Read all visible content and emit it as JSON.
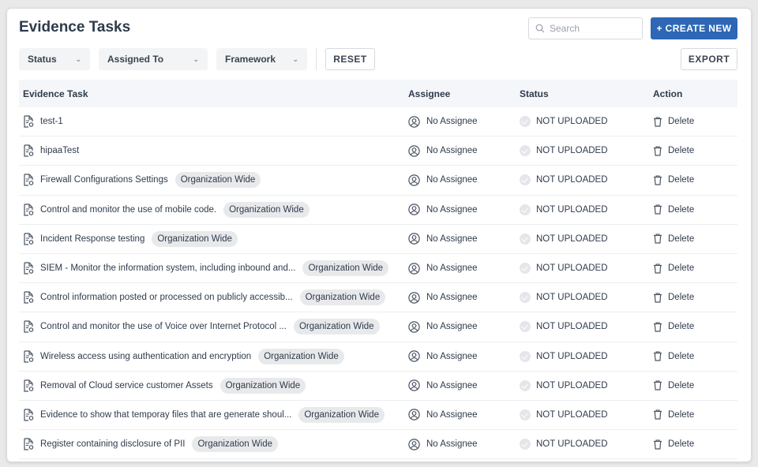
{
  "page": {
    "title": "Evidence Tasks"
  },
  "search": {
    "placeholder": "Search"
  },
  "buttons": {
    "create_new": "+ CREATE NEW",
    "reset": "RESET",
    "export": "EXPORT"
  },
  "filters": [
    {
      "label": "Status"
    },
    {
      "label": "Assigned To"
    },
    {
      "label": "Framework"
    }
  ],
  "table": {
    "headers": {
      "task": "Evidence Task",
      "assignee": "Assignee",
      "status": "Status",
      "action": "Action"
    },
    "rows": [
      {
        "task": "test-1",
        "tag": "",
        "assignee": "No Assignee",
        "status": "NOT UPLOADED",
        "action": "Delete"
      },
      {
        "task": "hipaaTest",
        "tag": "",
        "assignee": "No Assignee",
        "status": "NOT UPLOADED",
        "action": "Delete"
      },
      {
        "task": "Firewall Configurations Settings",
        "tag": "Organization Wide",
        "assignee": "No Assignee",
        "status": "NOT UPLOADED",
        "action": "Delete"
      },
      {
        "task": "Control and monitor the use of mobile code.",
        "tag": "Organization Wide",
        "assignee": "No Assignee",
        "status": "NOT UPLOADED",
        "action": "Delete"
      },
      {
        "task": "Incident Response testing",
        "tag": "Organization Wide",
        "assignee": "No Assignee",
        "status": "NOT UPLOADED",
        "action": "Delete"
      },
      {
        "task": "SIEM - Monitor the information system, including inbound and...",
        "tag": "Organization Wide",
        "assignee": "No Assignee",
        "status": "NOT UPLOADED",
        "action": "Delete"
      },
      {
        "task": "Control information posted or processed on publicly accessib...",
        "tag": "Organization Wide",
        "assignee": "No Assignee",
        "status": "NOT UPLOADED",
        "action": "Delete"
      },
      {
        "task": "Control and monitor the use of Voice over Internet Protocol ...",
        "tag": "Organization Wide",
        "assignee": "No Assignee",
        "status": "NOT UPLOADED",
        "action": "Delete"
      },
      {
        "task": "Wireless access using authentication and encryption",
        "tag": "Organization Wide",
        "assignee": "No Assignee",
        "status": "NOT UPLOADED",
        "action": "Delete"
      },
      {
        "task": "Removal of Cloud service customer Assets",
        "tag": "Organization Wide",
        "assignee": "No Assignee",
        "status": "NOT UPLOADED",
        "action": "Delete"
      },
      {
        "task": "Evidence to show that temporay files that are generate shoul...",
        "tag": "Organization Wide",
        "assignee": "No Assignee",
        "status": "NOT UPLOADED",
        "action": "Delete"
      },
      {
        "task": "Register containing disclosure of PII",
        "tag": "Organization Wide",
        "assignee": "No Assignee",
        "status": "NOT UPLOADED",
        "action": "Delete"
      }
    ]
  },
  "colors": {
    "primary": "#2d67b5",
    "header_bg": "#f4f6f9",
    "tag_bg": "#e8e9eb",
    "status_dot": "#e4e6ea"
  },
  "icons": {
    "search": "search-icon",
    "task": "document-gear-icon",
    "assignee": "user-circle-icon",
    "status": "check-circle-icon",
    "action": "trash-icon",
    "filter": "chevron-down-icon"
  }
}
